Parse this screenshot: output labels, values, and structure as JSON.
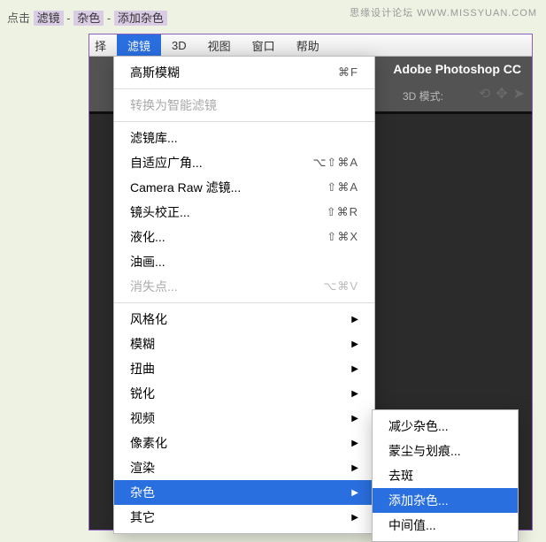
{
  "watermark": "思缘设计论坛  WWW.MISSYUAN.COM",
  "instruction": {
    "prefix": "点击",
    "tag1": "滤镜",
    "sep": " - ",
    "tag2": "杂色",
    "tag3": "添加杂色"
  },
  "menubar": {
    "trunc": "择",
    "filter": "滤镜",
    "threeD": "3D",
    "view": "视图",
    "window": "窗口",
    "help": "帮助"
  },
  "app_title": "Adobe Photoshop CC",
  "mode_label": "3D 模式:",
  "dropdown": {
    "recent": {
      "label": "高斯模糊",
      "shortcut": "⌘F"
    },
    "convert_smart": "转换为智能滤镜",
    "filter_gallery": "滤镜库...",
    "adaptive_wide": {
      "label": "自适应广角...",
      "shortcut": "⌥⇧⌘A"
    },
    "camera_raw": {
      "label": "Camera Raw 滤镜...",
      "shortcut": "⇧⌘A"
    },
    "lens_correction": {
      "label": "镜头校正...",
      "shortcut": "⇧⌘R"
    },
    "liquify": {
      "label": "液化...",
      "shortcut": "⇧⌘X"
    },
    "oil_paint": "油画...",
    "vanishing_point": {
      "label": "消失点...",
      "shortcut": "⌥⌘V"
    },
    "stylize": "风格化",
    "blur": "模糊",
    "distort": "扭曲",
    "sharpen": "锐化",
    "video": "视频",
    "pixelate": "像素化",
    "render": "渲染",
    "noise": "杂色",
    "other": "其它"
  },
  "submenu": {
    "reduce_noise": "减少杂色...",
    "dust_scratches": "蒙尘与划痕...",
    "despeckle": "去斑",
    "add_noise": "添加杂色...",
    "median": "中间值..."
  }
}
